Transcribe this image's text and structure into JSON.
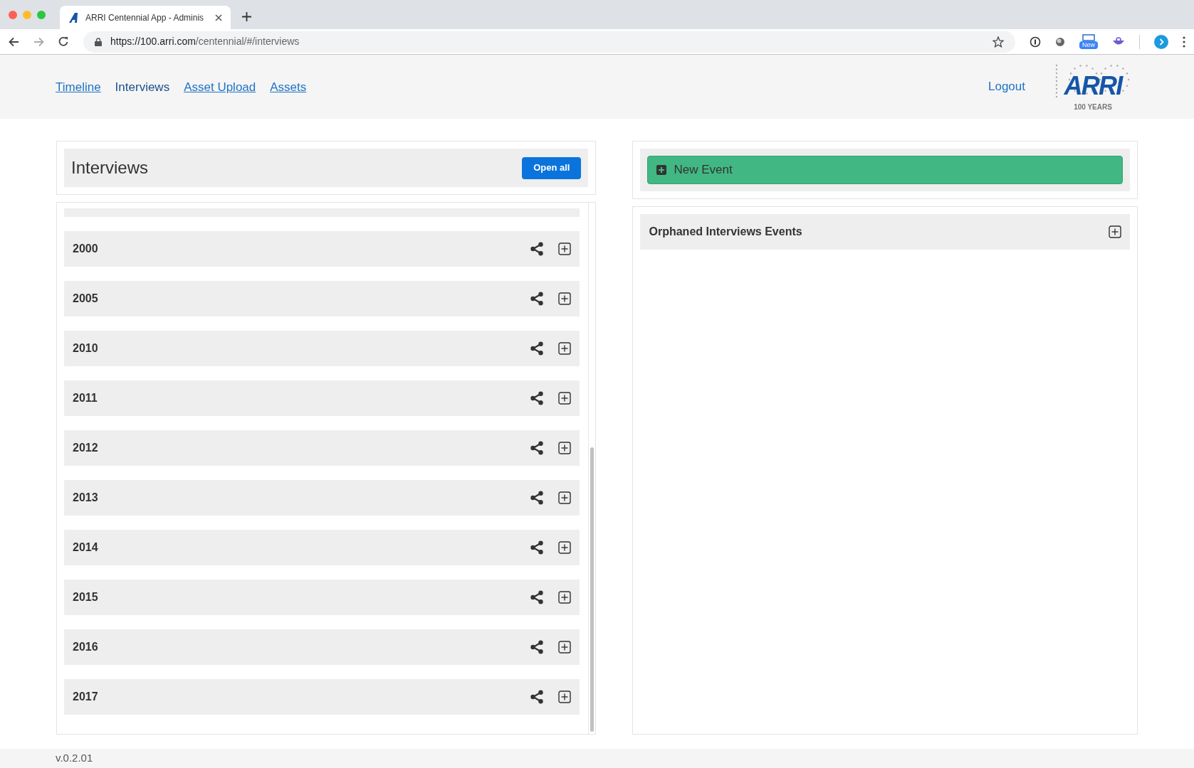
{
  "browser": {
    "tab_title": "ARRI Centennial App - Adminis",
    "url_host": "https://100.arri.com",
    "url_path": "/centennial/#/interviews",
    "extension_badge": "New"
  },
  "nav": {
    "links": [
      {
        "label": "Timeline",
        "selected": false
      },
      {
        "label": "Interviews",
        "selected": true
      },
      {
        "label": "Asset Upload",
        "selected": false
      },
      {
        "label": "Assets",
        "selected": false
      }
    ],
    "logout": "Logout",
    "logo": {
      "wordmark": "ARRI",
      "tagline": "100 YEARS"
    }
  },
  "interviews": {
    "title": "Interviews",
    "open_all": "Open all",
    "years": [
      "2000",
      "2005",
      "2010",
      "2011",
      "2012",
      "2013",
      "2014",
      "2015",
      "2016",
      "2017"
    ]
  },
  "events": {
    "new_event": "New Event",
    "orphaned_title": "Orphaned Interviews Events"
  },
  "footer": {
    "version": "v.0.2.01"
  }
}
